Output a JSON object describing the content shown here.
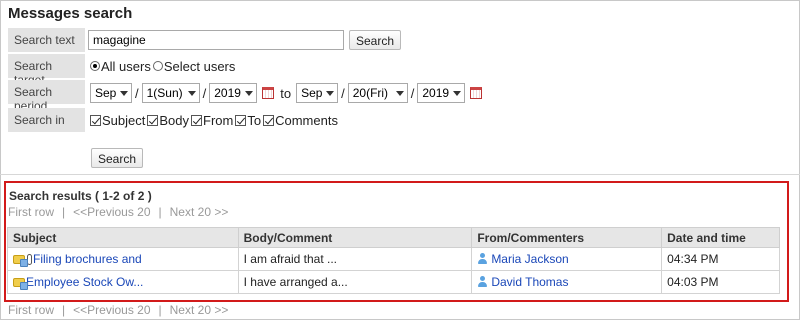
{
  "page": {
    "title": "Messages search"
  },
  "form": {
    "search_text": {
      "label": "Search text",
      "value": "magagine",
      "button": "Search"
    },
    "search_target": {
      "label": "Search target",
      "options": [
        "All users",
        "Select users"
      ],
      "selected": "All users"
    },
    "search_period": {
      "label": "Search period",
      "from": {
        "month": "Sep",
        "day": "1(Sun)",
        "year": "2019"
      },
      "to_label": "to",
      "to": {
        "month": "Sep",
        "day": "20(Fri)",
        "year": "2019"
      },
      "separator": "/"
    },
    "search_in": {
      "label": "Search in",
      "options": [
        {
          "label": "Subject",
          "checked": true
        },
        {
          "label": "Body",
          "checked": true
        },
        {
          "label": "From",
          "checked": true
        },
        {
          "label": "To",
          "checked": true
        },
        {
          "label": "Comments",
          "checked": true
        }
      ]
    },
    "submit_button": "Search"
  },
  "results": {
    "title": "Search results ( 1-2 of 2 )",
    "pager": {
      "first": "First row",
      "separator": "|",
      "previous": "<<Previous 20",
      "next": "Next 20 >>"
    },
    "columns": [
      "Subject",
      "Body/Comment",
      "From/Commenters",
      "Date and time"
    ],
    "rows": [
      {
        "subject": "Filing brochures and",
        "has_attachment": true,
        "body": "I am afraid that ...",
        "from": "Maria Jackson",
        "date": "04:34 PM"
      },
      {
        "subject": "Employee Stock Ow...",
        "has_attachment": false,
        "body": "I have arranged a...",
        "from": "David Thomas",
        "date": "04:03 PM"
      }
    ]
  },
  "colors": {
    "highlight_border": "#d21a1a",
    "link": "#1a47b8",
    "label_bg": "#e3e3e3",
    "pager_text": "#999999"
  },
  "icons": [
    "calendar-icon",
    "message-icon",
    "attachment-icon",
    "user-icon",
    "dropdown-caret-icon"
  ]
}
